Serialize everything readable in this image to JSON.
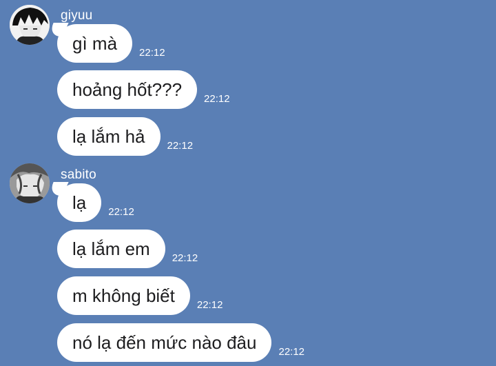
{
  "groups": [
    {
      "sender": "giyuu",
      "avatar_icon": "anime-avatar-giyuu-icon",
      "messages": [
        {
          "text": "gì mà",
          "time": "22:12"
        },
        {
          "text": "hoảng hốt???",
          "time": "22:12"
        },
        {
          "text": "lạ lắm hả",
          "time": "22:12"
        }
      ]
    },
    {
      "sender": "sabito",
      "avatar_icon": "anime-avatar-sabito-icon",
      "messages": [
        {
          "text": "lạ",
          "time": "22:12"
        },
        {
          "text": "lạ lắm em",
          "time": "22:12"
        },
        {
          "text": "m không biết",
          "time": "22:12"
        },
        {
          "text": "nó lạ đến mức nào đâu",
          "time": "22:12"
        }
      ]
    }
  ],
  "colors": {
    "background": "#5a7fb5",
    "bubble": "#ffffff",
    "text": "#1d1d1f"
  }
}
